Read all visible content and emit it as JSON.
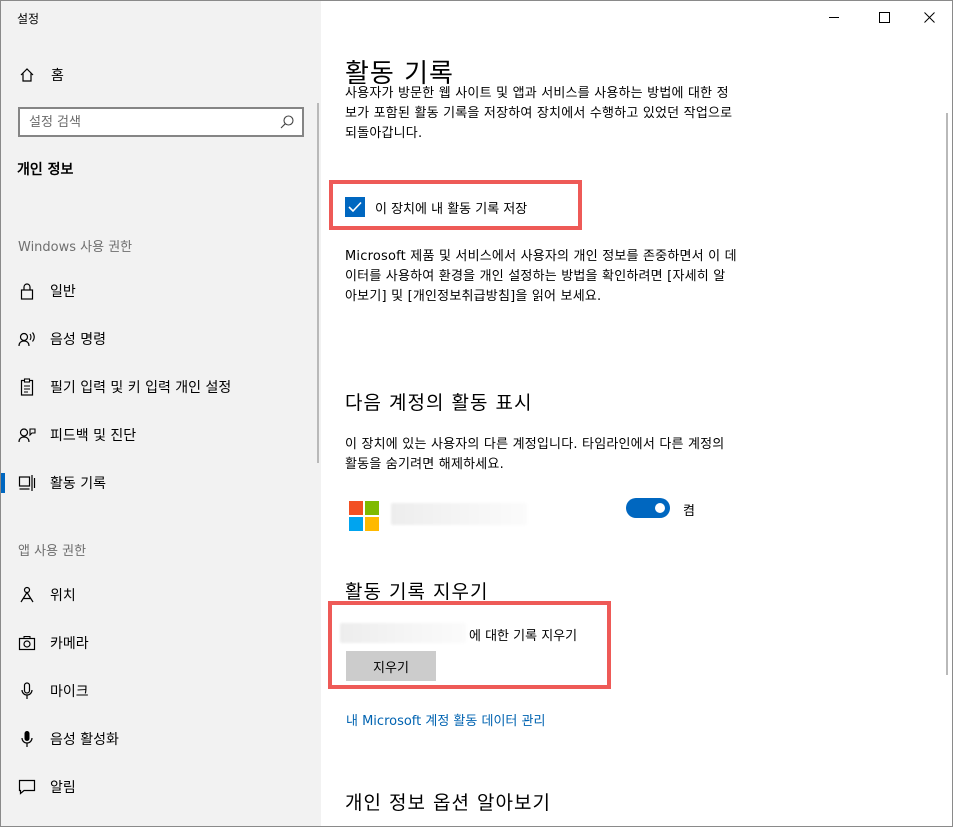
{
  "window": {
    "title": "설정"
  },
  "sidebar": {
    "home_label": "홈",
    "search_placeholder": "설정 검색",
    "section_title": "개인 정보",
    "group_windows": "Windows 사용 권한",
    "windows_items": [
      {
        "label": "일반",
        "icon": "lock-icon"
      },
      {
        "label": "음성 명령",
        "icon": "speech-icon"
      },
      {
        "label": "필기 입력 및 키 입력 개인 설정",
        "icon": "clipboard-icon"
      },
      {
        "label": "피드백 및 진단",
        "icon": "feedback-icon"
      },
      {
        "label": "활동 기록",
        "icon": "timeline-icon",
        "active": true
      }
    ],
    "group_apps": "앱 사용 권한",
    "app_items": [
      {
        "label": "위치",
        "icon": "location-icon"
      },
      {
        "label": "카메라",
        "icon": "camera-icon"
      },
      {
        "label": "마이크",
        "icon": "microphone-icon"
      },
      {
        "label": "음성 활성화",
        "icon": "voice-activation-icon"
      },
      {
        "label": "알림",
        "icon": "notification-icon"
      }
    ]
  },
  "main": {
    "title": "활동 기록",
    "intro_lines": [
      "사용자가 방문한 웹 사이트 및 앱과 서비스를 사용하는 방법에 대한 정",
      "보가 포함된 활동 기록을 저장하여 장치에서 수행하고 있었던 작업으로",
      "되돌아갑니다."
    ],
    "store_checkbox_label": "이 장치에 내 활동 기록 저장",
    "store_checkbox_checked": true,
    "ms_lines": [
      "Microsoft 제품 및 서비스에서 사용자의 개인 정보를 존중하면서 이 데",
      "이터를 사용하여 환경을 개인 설정하는 방법을 확인하려면 [자세히 알",
      "아보기] 및 [개인정보취급방침]을 읽어 보세요."
    ],
    "accounts_title": "다음 계정의 활동 표시",
    "accounts_lines": [
      "이 장치에 있는 사용자의 다른 계정입니다. 타임라인에서 다른 계정의",
      "활동을 숨기려면 해제하세요."
    ],
    "account_toggle_on": true,
    "account_toggle_label": "켬",
    "clear_title": "활동 기록 지우기",
    "clear_text": "에 대한 기록 지우기",
    "clear_button": "지우기",
    "manage_link": "내 Microsoft 계정 활동 데이터 관리",
    "learn_title": "개인 정보 옵션 알아보기"
  },
  "colors": {
    "accent": "#0067c0",
    "highlight_box": "#ee5a57",
    "link": "#0063b1"
  }
}
